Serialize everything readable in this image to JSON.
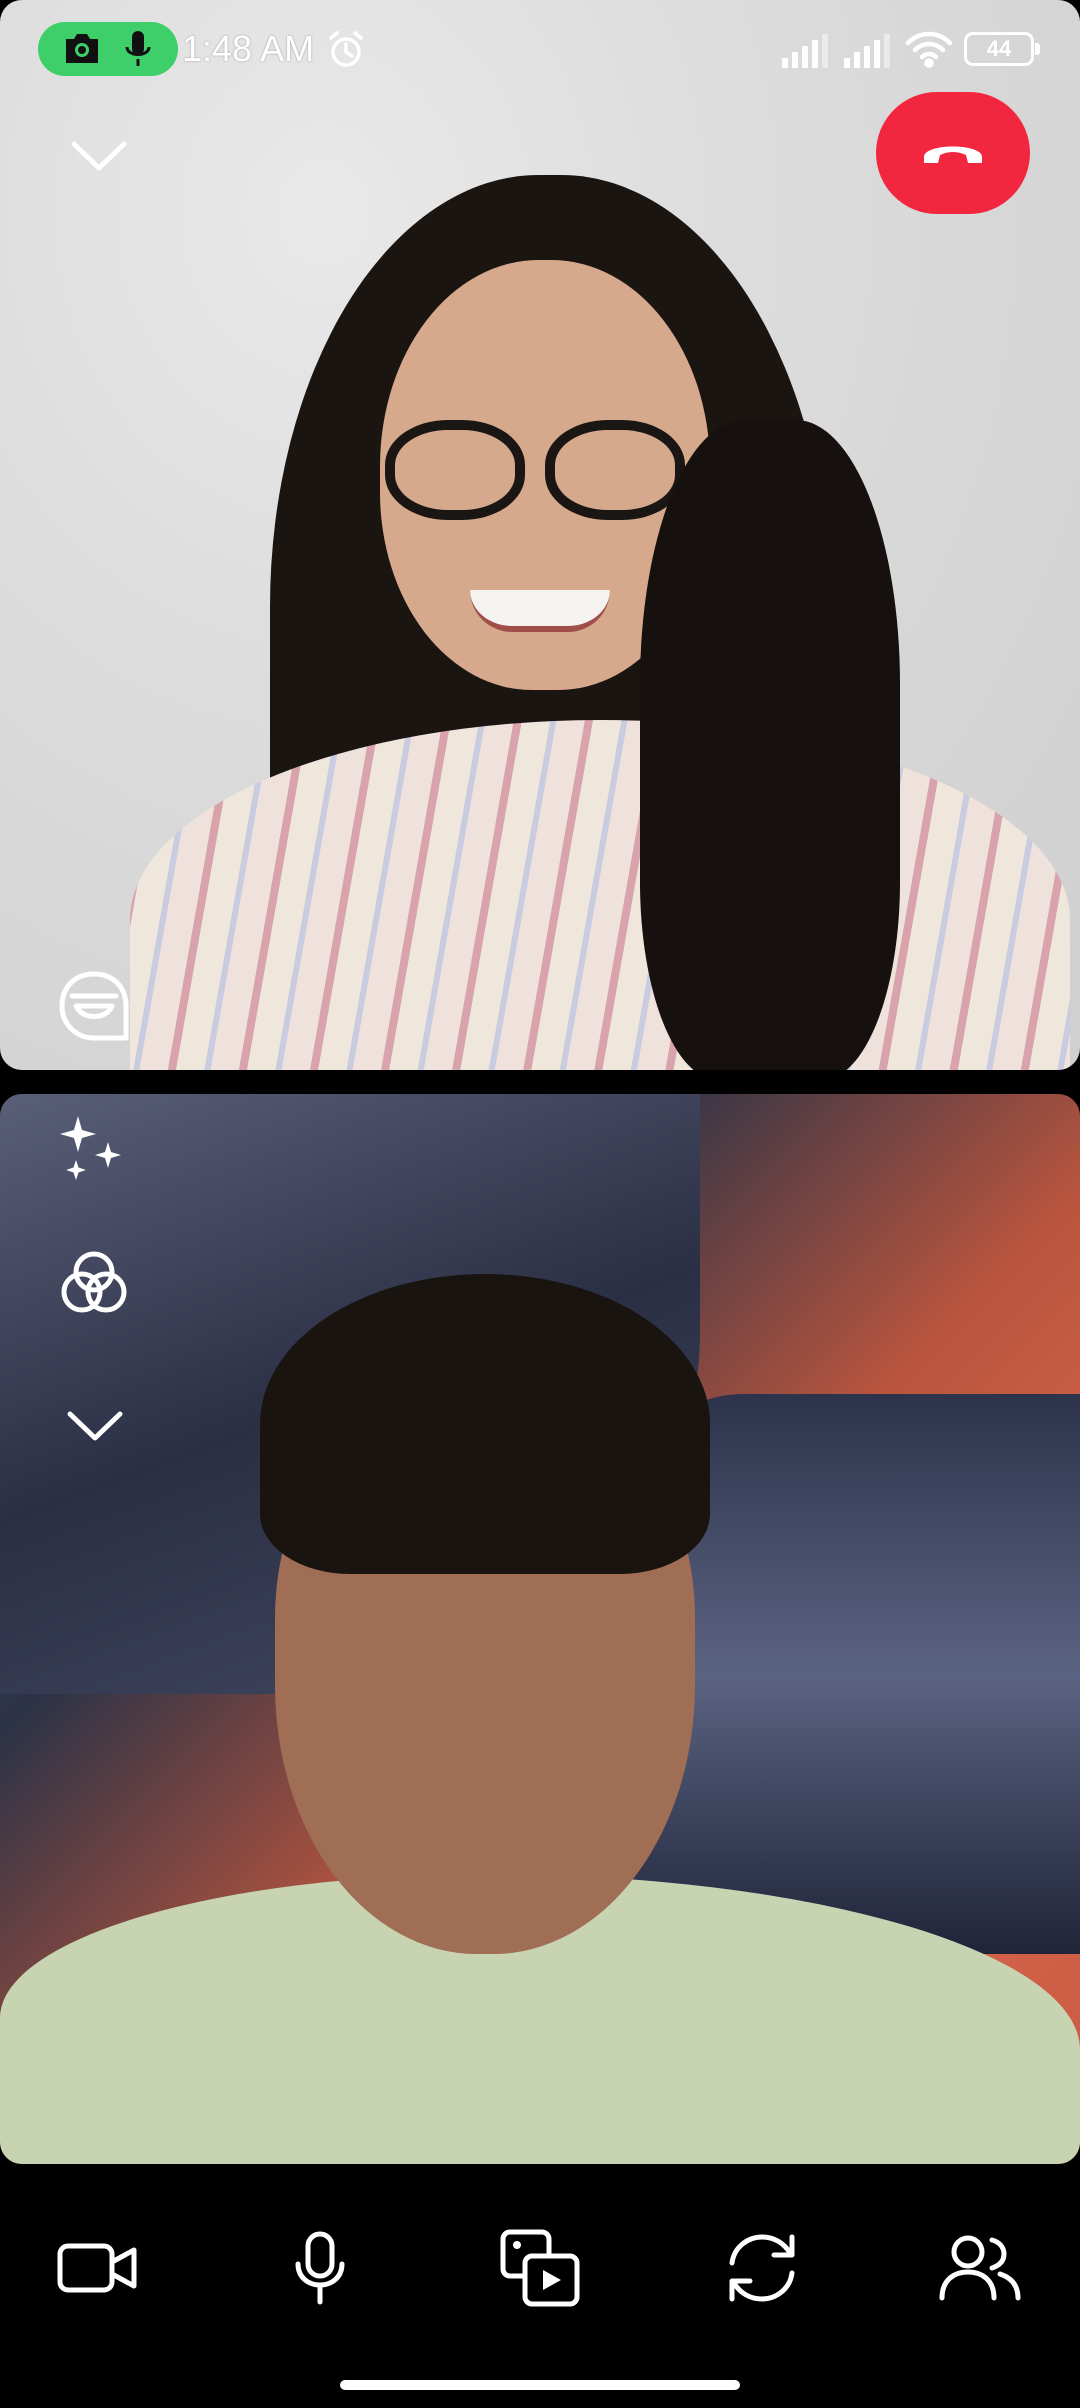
{
  "status_bar": {
    "time": "1:48 AM",
    "battery": "44",
    "privacy_indicator_icons": [
      "camera-icon",
      "microphone-icon"
    ],
    "right_icons": [
      "signal-icon",
      "signal-icon",
      "wifi-icon",
      "battery-icon"
    ]
  },
  "call": {
    "remote_tile": {
      "controls": [
        "collapse-chevron-icon",
        "end-call-icon",
        "sticker-icon"
      ]
    },
    "local_tile": {
      "controls": [
        "effects-sparkle-icon",
        "filters-icon",
        "collapse-chevron-icon"
      ]
    }
  },
  "toolbar": {
    "buttons": [
      "video-camera-icon",
      "microphone-icon",
      "media-share-icon",
      "flip-camera-icon",
      "add-people-icon"
    ]
  },
  "colors": {
    "end_call": "#f3263f",
    "privacy_pill": "#3ecf6b",
    "toolbar_bg": "#000000"
  }
}
